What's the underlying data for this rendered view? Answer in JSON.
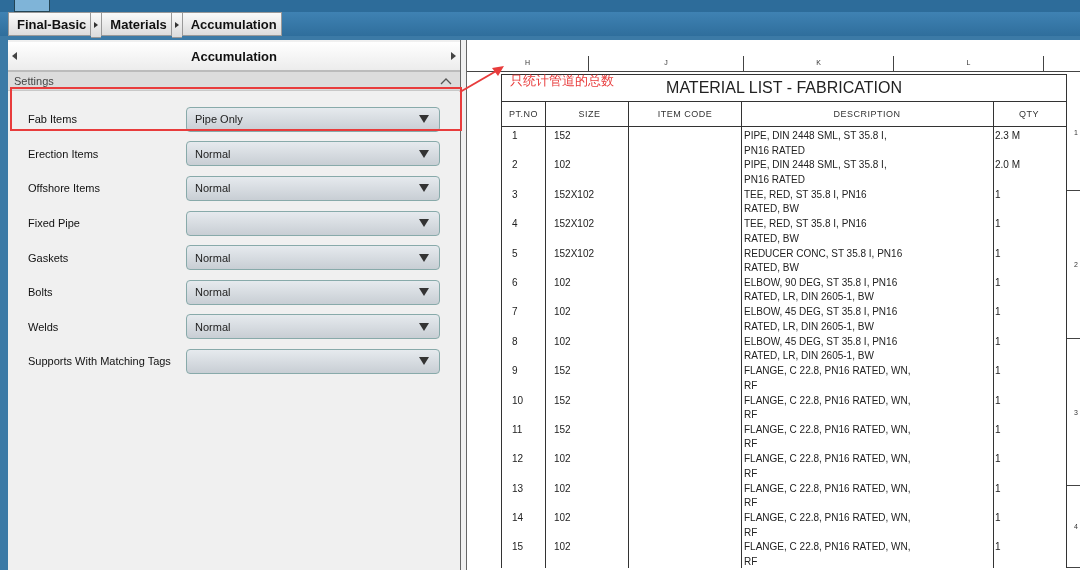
{
  "breadcrumb": [
    {
      "label": "Final-Basic"
    },
    {
      "label": "Materials"
    },
    {
      "label": "Accumulation"
    }
  ],
  "panel": {
    "title": "Accumulation",
    "section": {
      "title": "Settings",
      "expanded": true
    },
    "settings": [
      {
        "label": "Fab Items",
        "value": "Pipe Only"
      },
      {
        "label": "Erection Items",
        "value": "Normal"
      },
      {
        "label": "Offshore Items",
        "value": "Normal"
      },
      {
        "label": "Fixed Pipe"
      },
      {
        "label": "Gaskets",
        "value": "Normal"
      },
      {
        "label": "Bolts",
        "value": "Normal"
      },
      {
        "label": "Welds",
        "value": "Normal"
      },
      {
        "label": "Supports With Matching Tags"
      }
    ]
  },
  "annotation": {
    "text": "只统计管道的总数"
  },
  "drawing": {
    "grid_columns": [
      "H",
      "J",
      "K",
      "L"
    ],
    "grid_rows": [
      "1",
      "2",
      "3",
      "4"
    ],
    "table": {
      "title": "MATERIAL LIST - FABRICATION",
      "columns": [
        "PT.NO",
        "SIZE",
        "ITEM CODE",
        "DESCRIPTION",
        "QTY"
      ],
      "rows": [
        {
          "pt_no": "1",
          "size": "152",
          "description": [
            "PIPE, DIN 2448 SML, ST 35.8 I,",
            "PN16 RATED"
          ],
          "qty": "2.3 M"
        },
        {
          "pt_no": "2",
          "size": "102",
          "description": [
            "PIPE, DIN 2448 SML, ST 35.8 I,",
            "PN16 RATED"
          ],
          "qty": "2.0 M"
        },
        {
          "pt_no": "3",
          "size": "152X102",
          "description": [
            "TEE, RED, ST 35.8 I, PN16",
            "RATED, BW"
          ],
          "qty": "1"
        },
        {
          "pt_no": "4",
          "size": "152X102",
          "description": [
            "TEE, RED, ST 35.8 I, PN16",
            "RATED, BW"
          ],
          "qty": "1"
        },
        {
          "pt_no": "5",
          "size": "152X102",
          "description": [
            "REDUCER CONC, ST 35.8 I, PN16",
            "RATED, BW"
          ],
          "qty": "1"
        },
        {
          "pt_no": "6",
          "size": "102",
          "description": [
            "ELBOW, 90 DEG, ST 35.8 I, PN16",
            "RATED, LR, DIN 2605-1, BW"
          ],
          "qty": "1"
        },
        {
          "pt_no": "7",
          "size": "102",
          "description": [
            "ELBOW, 45 DEG, ST 35.8 I, PN16",
            "RATED, LR, DIN 2605-1, BW"
          ],
          "qty": "1"
        },
        {
          "pt_no": "8",
          "size": "102",
          "description": [
            "ELBOW, 45 DEG, ST 35.8 I, PN16",
            "RATED, LR, DIN 2605-1, BW"
          ],
          "qty": "1"
        },
        {
          "pt_no": "9",
          "size": "152",
          "description": [
            "FLANGE, C 22.8, PN16 RATED, WN,",
            "RF"
          ],
          "qty": "1"
        },
        {
          "pt_no": "10",
          "size": "152",
          "description": [
            "FLANGE, C 22.8, PN16 RATED, WN,",
            "RF"
          ],
          "qty": "1"
        },
        {
          "pt_no": "11",
          "size": "152",
          "description": [
            "FLANGE, C 22.8, PN16 RATED, WN,",
            "RF"
          ],
          "qty": "1"
        },
        {
          "pt_no": "12",
          "size": "102",
          "description": [
            "FLANGE, C 22.8, PN16 RATED, WN,",
            "RF"
          ],
          "qty": "1"
        },
        {
          "pt_no": "13",
          "size": "102",
          "description": [
            "FLANGE, C 22.8, PN16 RATED, WN,",
            "RF"
          ],
          "qty": "1"
        },
        {
          "pt_no": "14",
          "size": "102",
          "description": [
            "FLANGE, C 22.8, PN16 RATED, WN,",
            "RF"
          ],
          "qty": "1"
        },
        {
          "pt_no": "15",
          "size": "102",
          "description": [
            "FLANGE, C 22.8, PN16 RATED, WN,",
            "RF"
          ],
          "qty": "1"
        }
      ]
    }
  }
}
